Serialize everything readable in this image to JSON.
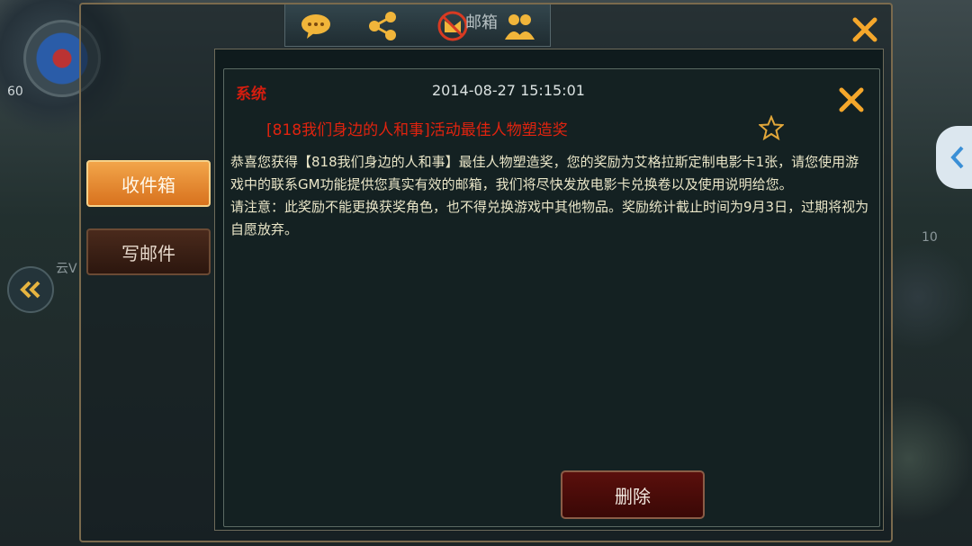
{
  "hud": {
    "level": "60",
    "right_value": "10",
    "left_partial_label": "云V"
  },
  "tabs": {
    "title": "邮箱",
    "icons": [
      "chat-icon",
      "share-icon",
      "mail-icon",
      "friends-icon"
    ]
  },
  "sidebar": {
    "inbox_label": "收件箱",
    "write_label": "写邮件"
  },
  "mail": {
    "sender": "系统",
    "date": "2014-08-27 15:15:01",
    "subject": "[818我们身边的人和事]活动最佳人物塑造奖",
    "body": [
      "恭喜您获得【818我们身边的人和事】最佳人物塑造奖，您的奖励为艾格拉斯定制电影卡1张，请您使用游戏中的联系GM功能提供您真实有效的邮箱，我们将尽快发放电影卡兑换卷以及使用说明给您。",
      "请注意：此奖励不能更换获奖角色，也不得兑换游戏中其他物品。奖励统计截止时间为9月3日，过期将视为自愿放弃。"
    ],
    "delete_label": "删除"
  },
  "colors": {
    "accent_orange": "#f2a54a",
    "sender_red": "#d41d0f",
    "close_orange": "#f5a72b"
  }
}
